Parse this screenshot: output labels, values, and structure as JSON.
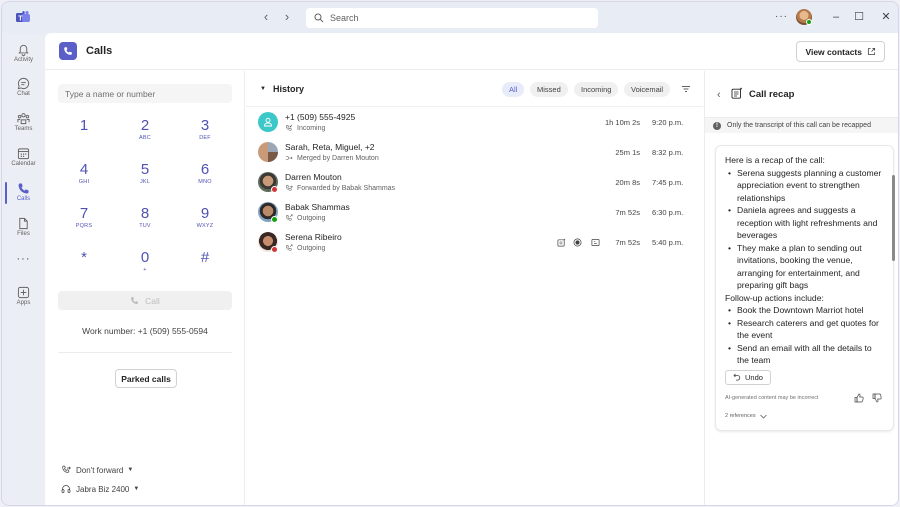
{
  "titlebar": {
    "search_placeholder": "Search",
    "more_label": "···",
    "minimize": "–",
    "maximize": "☐",
    "close": "✕",
    "back_arrow": "‹",
    "forward_arrow": "›"
  },
  "rail": {
    "items": [
      {
        "label": "Activity",
        "icon": "bell-icon"
      },
      {
        "label": "Chat",
        "icon": "chat-icon"
      },
      {
        "label": "Teams",
        "icon": "teams-icon"
      },
      {
        "label": "Calendar",
        "icon": "calendar-icon"
      },
      {
        "label": "Calls",
        "icon": "phone-icon",
        "active": true
      },
      {
        "label": "Files",
        "icon": "file-icon"
      },
      {
        "label": "···",
        "icon": "more-icon"
      },
      {
        "label": "Apps",
        "icon": "add-apps-icon"
      }
    ]
  },
  "header": {
    "title": "Calls",
    "view_contacts_label": "View contacts"
  },
  "dialpad": {
    "input_placeholder": "Type a name or number",
    "keys": [
      {
        "digit": "1",
        "letters": ""
      },
      {
        "digit": "2",
        "letters": "ABC"
      },
      {
        "digit": "3",
        "letters": "DEF"
      },
      {
        "digit": "4",
        "letters": "GHI"
      },
      {
        "digit": "5",
        "letters": "JKL"
      },
      {
        "digit": "6",
        "letters": "MNO"
      },
      {
        "digit": "7",
        "letters": "PQRS"
      },
      {
        "digit": "8",
        "letters": "TUV"
      },
      {
        "digit": "9",
        "letters": "WXYZ"
      },
      {
        "digit": "*",
        "letters": ""
      },
      {
        "digit": "0",
        "letters": "+"
      },
      {
        "digit": "#",
        "letters": ""
      }
    ],
    "call_label": "Call",
    "work_number": "Work number: +1 (509) 555-0594",
    "parked_calls_label": "Parked calls",
    "forward_label": "Don't forward",
    "device_label": "Jabra Biz 2400"
  },
  "history": {
    "title": "History",
    "filters": [
      {
        "label": "All",
        "active": true
      },
      {
        "label": "Missed",
        "active": false
      },
      {
        "label": "Incoming",
        "active": false
      },
      {
        "label": "Voicemail",
        "active": false
      }
    ],
    "rows": [
      {
        "name": "+1 (509) 555-4925",
        "sub": "Incoming",
        "duration": "1h 10m 2s",
        "time": "9:20 p.m."
      },
      {
        "name": "Sarah, Reta, Miguel, +2",
        "sub": "Merged by Darren Mouton",
        "duration": "25m 1s",
        "time": "8:32 p.m."
      },
      {
        "name": "Darren Mouton",
        "sub": "Forwarded by Babak Shammas",
        "duration": "20m 8s",
        "time": "7:45 p.m."
      },
      {
        "name": "Babak Shammas",
        "sub": "Outgoing",
        "duration": "7m 52s",
        "time": "6:30 p.m."
      },
      {
        "name": "Serena Ribeiro",
        "sub": "Outgoing",
        "duration": "7m 52s",
        "time": "5:40 p.m."
      }
    ]
  },
  "recap": {
    "title": "Call recap",
    "info": "Only the transcript of this call can be recapped",
    "intro": "Here is a recap of the call:",
    "points": [
      "Serena suggests planning a customer appreciation event to strengthen relationships",
      "Daniela agrees and suggests a reception with light refreshments and beverages",
      "They make a plan to sending out invitations, booking the venue, arranging for entertainment, and preparing gift bags"
    ],
    "followup_intro": "Follow-up actions include:",
    "followups": [
      "Book the Downtown Marriot hotel",
      "Research caterers and get quotes for the event",
      "Send an email with all the details to the team"
    ],
    "undo_label": "Undo",
    "disclaimer": "AI-generated content may be incorrect",
    "references": "2 references"
  },
  "colors": {
    "brand": "#5b5fc7",
    "presence_available": "#13a10e",
    "presence_busy": "#d13438",
    "avatar_teal": "#3cc8c8"
  }
}
